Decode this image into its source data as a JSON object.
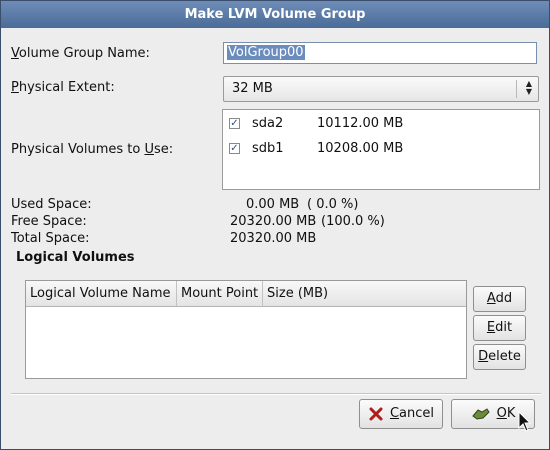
{
  "dialog": {
    "title": "Make LVM Volume Group"
  },
  "volume_group_name": {
    "label": "Volume Group Name:",
    "value": "VolGroup00"
  },
  "physical_extent": {
    "label": "Physical Extent:",
    "value": "32 MB"
  },
  "physical_volumes": {
    "label": "Physical Volumes to Use:",
    "items": [
      {
        "checked": true,
        "name": "sda2",
        "size": "10112.00 MB"
      },
      {
        "checked": true,
        "name": "sdb1",
        "size": "10208.00 MB"
      }
    ]
  },
  "space": {
    "used_label": "Used Space:",
    "used_value": "0.00 MB",
    "used_pct": "( 0.0 %)",
    "free_label": "Free Space:",
    "free_value": "20320.00 MB",
    "free_pct": "(100.0 %)",
    "total_label": "Total Space:",
    "total_value": "20320.00 MB"
  },
  "logical_volumes": {
    "title": "Logical Volumes",
    "columns": [
      "Logical Volume Name",
      "Mount Point",
      "Size (MB)"
    ],
    "add_label": "Add",
    "edit_label": "Edit",
    "delete_label": "Delete"
  },
  "buttons": {
    "cancel_label": "Cancel",
    "ok_label": "OK"
  },
  "icons": {
    "cancel": "cancel-x-icon",
    "ok": "ok-hand-icon",
    "check": "checkmark-icon"
  }
}
